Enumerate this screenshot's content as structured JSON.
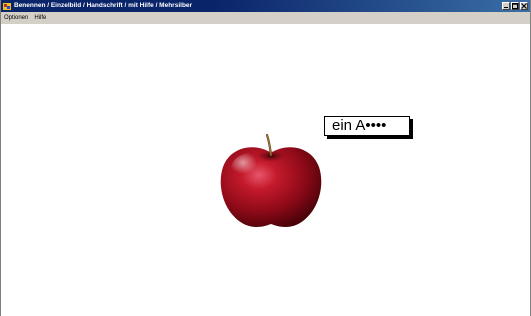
{
  "window": {
    "title": "Benennen / Einzelbild / Handschrift / mit Hilfe / Mehrsilber",
    "colors": {
      "titlebar_start": "#0a246a",
      "titlebar_end": "#3a6ea5",
      "menubar_bg": "#d4d0c8",
      "content_bg": "#ffffff"
    }
  },
  "menubar": {
    "items": [
      "Optionen",
      "Hilfe"
    ]
  },
  "caption_buttons": {
    "icons": [
      "minimize-icon",
      "maximize-icon",
      "close-icon"
    ]
  },
  "main": {
    "image_subject": "apple-icon",
    "word_hint": "ein A••••"
  }
}
